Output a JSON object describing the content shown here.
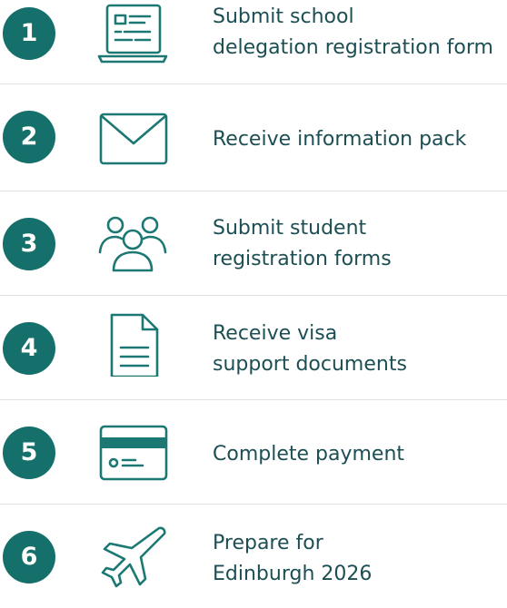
{
  "accent_color": "#15706b",
  "steps": [
    {
      "number": "1",
      "icon": "laptop-form-icon",
      "lines": [
        "Submit school",
        "delegation registration form"
      ]
    },
    {
      "number": "2",
      "icon": "envelope-icon",
      "lines": [
        "Receive information pack"
      ]
    },
    {
      "number": "3",
      "icon": "people-group-icon",
      "lines": [
        "Submit student",
        "registration forms"
      ]
    },
    {
      "number": "4",
      "icon": "document-icon",
      "lines": [
        "Receive visa",
        "support documents"
      ]
    },
    {
      "number": "5",
      "icon": "credit-card-icon",
      "lines": [
        "Complete payment"
      ]
    },
    {
      "number": "6",
      "icon": "airplane-icon",
      "lines": [
        "Prepare for",
        "Edinburgh 2026"
      ]
    }
  ]
}
